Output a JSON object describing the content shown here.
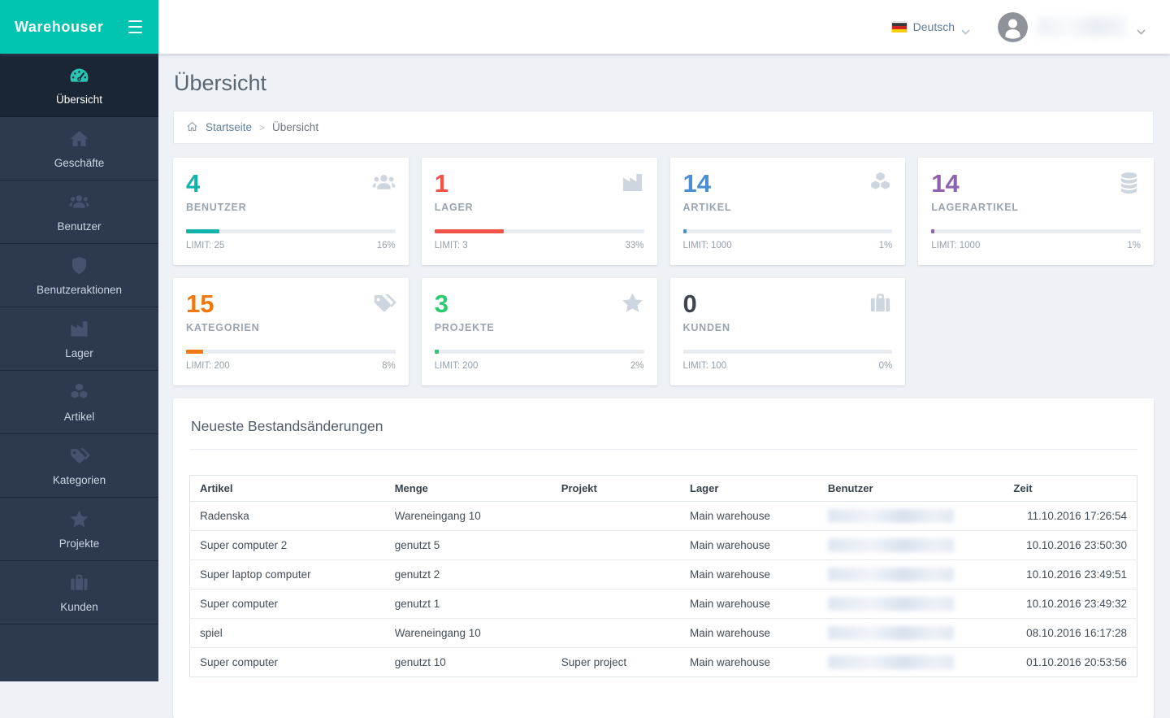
{
  "theme": {
    "header_teal": "#00c3b0",
    "sidebar_bg": "#2c394f",
    "sidebar_active_bg": "#1b2635",
    "active_icon_teal": "#2bc4b2",
    "content_bg": "#eef1f5"
  },
  "brand": {
    "logo_text": "Warehouser"
  },
  "topbar": {
    "language": {
      "label": "Deutsch",
      "flag": "german-flag-icon"
    },
    "user": {
      "name_redacted": true
    }
  },
  "page": {
    "title": "Übersicht",
    "breadcrumb": {
      "home": "Startseite",
      "separator": ">",
      "current": "Übersicht"
    }
  },
  "sidebar": {
    "items": [
      {
        "key": "uebersicht",
        "label": "Übersicht",
        "icon": "gauge",
        "active": true
      },
      {
        "key": "geschaefte",
        "label": "Geschäfte",
        "icon": "home",
        "active": false
      },
      {
        "key": "benutzer",
        "label": "Benutzer",
        "icon": "users",
        "active": false
      },
      {
        "key": "benutzeraktionen",
        "label": "Benutzeraktionen",
        "icon": "shield",
        "active": false
      },
      {
        "key": "lager",
        "label": "Lager",
        "icon": "industry",
        "active": false
      },
      {
        "key": "artikel",
        "label": "Artikel",
        "icon": "cubes",
        "active": false
      },
      {
        "key": "kategorien",
        "label": "Kategorien",
        "icon": "tags",
        "active": false
      },
      {
        "key": "projekte",
        "label": "Projekte",
        "icon": "star",
        "active": false
      },
      {
        "key": "kunden",
        "label": "Kunden",
        "icon": "suitcase",
        "active": false
      }
    ]
  },
  "stats": [
    {
      "key": "benutzer",
      "value": "4",
      "label": "BENUTZER",
      "icon": "users",
      "color": "#11b3ac",
      "percent": 16,
      "limit_label": "LIMIT: 25",
      "percent_label": "16%"
    },
    {
      "key": "lager",
      "value": "1",
      "label": "LAGER",
      "icon": "industry",
      "color": "#f25349",
      "percent": 33,
      "limit_label": "LIMIT: 3",
      "percent_label": "33%"
    },
    {
      "key": "artikel",
      "value": "14",
      "label": "ARTIKEL",
      "icon": "cubes",
      "color": "#4a8fd4",
      "percent": 1,
      "limit_label": "LIMIT: 1000",
      "percent_label": "1%"
    },
    {
      "key": "lagerartikel",
      "value": "14",
      "label": "LAGERARTIKEL",
      "icon": "database",
      "color": "#8d63ad",
      "percent": 1,
      "limit_label": "LIMIT: 1000",
      "percent_label": "1%"
    },
    {
      "key": "kategorien",
      "value": "15",
      "label": "KATEGORIEN",
      "icon": "tags",
      "color": "#f0790f",
      "percent": 8,
      "limit_label": "LIMIT: 200",
      "percent_label": "8%"
    },
    {
      "key": "projekte",
      "value": "3",
      "label": "PROJEKTE",
      "icon": "star",
      "color": "#2bcc71",
      "percent": 2,
      "limit_label": "LIMIT: 200",
      "percent_label": "2%"
    },
    {
      "key": "kunden",
      "value": "0",
      "label": "KUNDEN",
      "icon": "suitcase",
      "color": "#3e454d",
      "percent": 0,
      "limit_label": "LIMIT: 100",
      "percent_label": "0%"
    }
  ],
  "panel": {
    "title": "Neueste Bestandsänderungen",
    "table": {
      "headers": [
        "Artikel",
        "Menge",
        "Projekt",
        "Lager",
        "Benutzer",
        "Zeit"
      ],
      "rows": [
        {
          "artikel": "Radenska",
          "menge": "Wareneingang 10",
          "projekt": "",
          "lager": "Main warehouse",
          "benutzer_redacted": true,
          "zeit": "11.10.2016 17:26:54"
        },
        {
          "artikel": "Super computer 2",
          "menge": "genutzt 5",
          "projekt": "",
          "lager": "Main warehouse",
          "benutzer_redacted": true,
          "zeit": "10.10.2016 23:50:30"
        },
        {
          "artikel": "Super laptop computer",
          "menge": "genutzt 2",
          "projekt": "",
          "lager": "Main warehouse",
          "benutzer_redacted": true,
          "zeit": "10.10.2016 23:49:51"
        },
        {
          "artikel": "Super computer",
          "menge": "genutzt 1",
          "projekt": "",
          "lager": "Main warehouse",
          "benutzer_redacted": true,
          "zeit": "10.10.2016 23:49:32"
        },
        {
          "artikel": "spiel",
          "menge": "Wareneingang 10",
          "projekt": "",
          "lager": "Main warehouse",
          "benutzer_redacted": true,
          "zeit": "08.10.2016 16:17:28"
        },
        {
          "artikel": "Super computer",
          "menge": "genutzt 10",
          "projekt": "Super project",
          "lager": "Main warehouse",
          "benutzer_redacted": true,
          "zeit": "01.10.2016 20:53:56"
        }
      ]
    }
  }
}
